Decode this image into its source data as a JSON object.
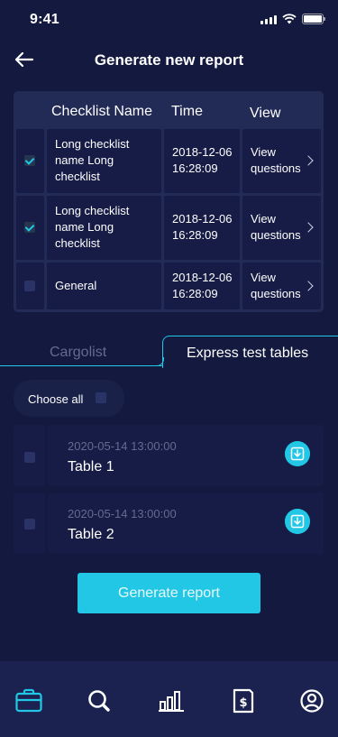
{
  "status_bar": {
    "time": "9:41"
  },
  "header": {
    "title": "Generate new report",
    "back_icon": "arrow-left-icon"
  },
  "checklist": {
    "columns": [
      "Checklist Name",
      "Time",
      "View"
    ],
    "rows": [
      {
        "checked": true,
        "name_lines": [
          "Long checklist",
          "name Long",
          "checklist"
        ],
        "time_lines": [
          "2018-12-06",
          "16:28:09"
        ],
        "view_lines": [
          "View",
          "questions"
        ]
      },
      {
        "checked": true,
        "name_lines": [
          "Long checklist",
          "name Long",
          "checklist"
        ],
        "time_lines": [
          "2018-12-06",
          "16:28:09"
        ],
        "view_lines": [
          "View",
          "questions"
        ]
      },
      {
        "checked": false,
        "name_lines": [
          "General"
        ],
        "time_lines": [
          "2018-12-06",
          "16:28:09"
        ],
        "view_lines": [
          "View",
          "questions"
        ]
      }
    ]
  },
  "tabs": {
    "items": [
      "Cargolist",
      "Express test tables"
    ],
    "active": "Express test tables"
  },
  "choose_all": {
    "label": "Choose all",
    "checked": false
  },
  "express_tables": [
    {
      "date": "2020-05-14 13:00:00",
      "name": "Table 1",
      "checked": false
    },
    {
      "date": "2020-05-14 13:00:00",
      "name": "Table 2",
      "checked": false
    }
  ],
  "generate_button": {
    "label": "Generate report"
  },
  "bottom_nav": {
    "items": [
      {
        "icon": "briefcase-icon",
        "active": true
      },
      {
        "icon": "search-icon",
        "active": false
      },
      {
        "icon": "bar-chart-icon",
        "active": false
      },
      {
        "icon": "invoice-dollar-icon",
        "active": false
      },
      {
        "icon": "user-icon",
        "active": false
      }
    ]
  },
  "colors": {
    "background": "#141a3f",
    "accent": "#22c7e6",
    "card": "#161c45",
    "table": "#222a56",
    "nav": "#1b2250",
    "muted_text": "#636b8f"
  }
}
